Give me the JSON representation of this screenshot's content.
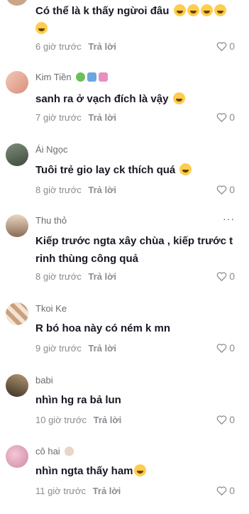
{
  "comments": [
    {
      "username": "",
      "text": "Có thể là k thấy ngừoi đâu",
      "time": "6 giờ trước",
      "reply": "Trả lời",
      "likes": "0",
      "emojis": 5
    },
    {
      "username": "Kim Tiền",
      "text": "sanh ra ở vạch đích là vậy",
      "time": "7 giờ trước",
      "reply": "Trả lời",
      "likes": "0",
      "emojis": 1,
      "badges": [
        "clover-icon",
        "scooter-icon",
        "gift-icon"
      ]
    },
    {
      "username": "Ái Ngọc",
      "text": "Tuôi trẻ gio lay ck thích quá",
      "time": "8 giờ trước",
      "reply": "Trả lời",
      "likes": "0",
      "emojis": 1
    },
    {
      "username": "Thu thỏ",
      "text": "Kiếp trước ngta xây chùa , kiếp trước t rinh thùng công quả",
      "time": "8 giờ trước",
      "reply": "Trả lời",
      "likes": "0",
      "emojis": 0,
      "more": "···"
    },
    {
      "username": "Tkoi Ke",
      "text": "R bó hoa này có ném k mn",
      "time": "9 giờ trước",
      "reply": "Trả lời",
      "likes": "0",
      "emojis": 0
    },
    {
      "username": "babi",
      "text": "nhìn hg ra bả lun",
      "time": "10 giờ trước",
      "reply": "Trả lời",
      "likes": "0",
      "emojis": 0
    },
    {
      "username": "cô hai",
      "text": "nhìn ngta thấy ham",
      "time": "11 giờ trước",
      "reply": "Trả lời",
      "likes": "0",
      "emojis": 1,
      "badges": [
        "bunny-icon"
      ]
    }
  ],
  "colors": {
    "text": "#161823",
    "muted": "#8a8b91",
    "emoji": "#ffcc4d"
  }
}
